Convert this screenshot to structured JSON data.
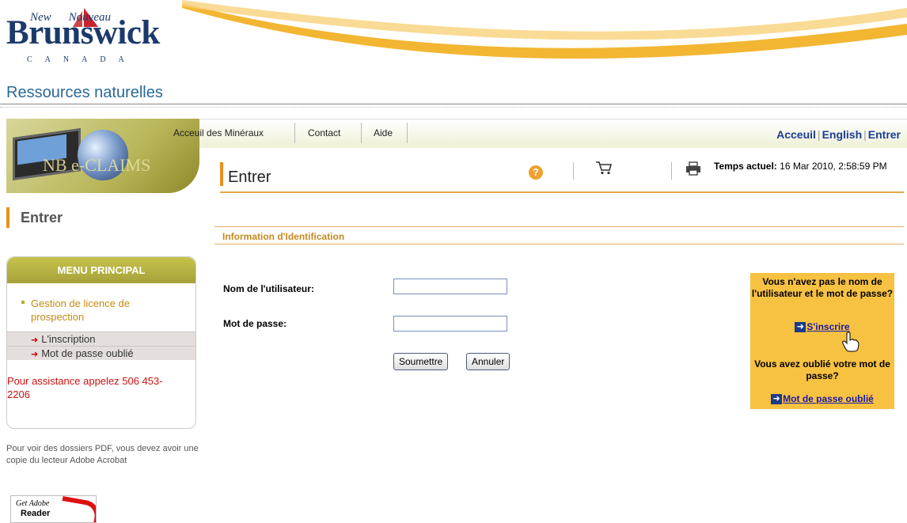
{
  "header": {
    "logo_top_left": "New",
    "logo_top_right": "Nouveau",
    "logo_brand": "Brunswick",
    "logo_country": "CANADA",
    "ministry": "Ressources naturelles"
  },
  "nav": {
    "banner_text": "NB e-CLAIMS",
    "items": [
      "Acceuil des Minéraux",
      "Contact",
      "Aide"
    ],
    "right": {
      "home": "Acceuil",
      "english": "English",
      "login": "Entrer"
    }
  },
  "page": {
    "title": "Entrer",
    "time_label": "Temps actuel:",
    "time_value": "16 Mar 2010, 2:58:59 PM"
  },
  "sidebar": {
    "title": "Entrer",
    "menu_heading": "MENU PRINCIPAL",
    "menu_link": "Gestion de licence de prospection",
    "sub_items": [
      "L'inscription",
      "Mot de passe oublié"
    ],
    "assistance": "Pour assistance appelez 506 453-2206",
    "pdf_note": "Pour voir des dossiers PDF, vous devez avoir une copie du lecteur Adobe Acrobat",
    "adobe_get": "Get Adobe",
    "adobe_reader": "Reader"
  },
  "form": {
    "section_label": "Information d'Identification",
    "username_label": "Nom de l'utilisateur:",
    "username_value": "",
    "password_label": "Mot de passe:",
    "password_value": "",
    "submit_label": "Soumettre",
    "cancel_label": "Annuler"
  },
  "helpbox": {
    "no_account_text": "Vous n'avez pas le nom de l'utilisateur et le mot de passe?",
    "register_link": "S'inscrire",
    "forgot_text": "Vous avez oublié votre mot de passe?",
    "forgot_link": "Mot de passe oublié"
  },
  "colors": {
    "accent_orange": "#e8901e",
    "link_blue": "#1a1aa6",
    "helpbox_yellow": "#f7c142",
    "menu_olive": "#b7b22b"
  }
}
